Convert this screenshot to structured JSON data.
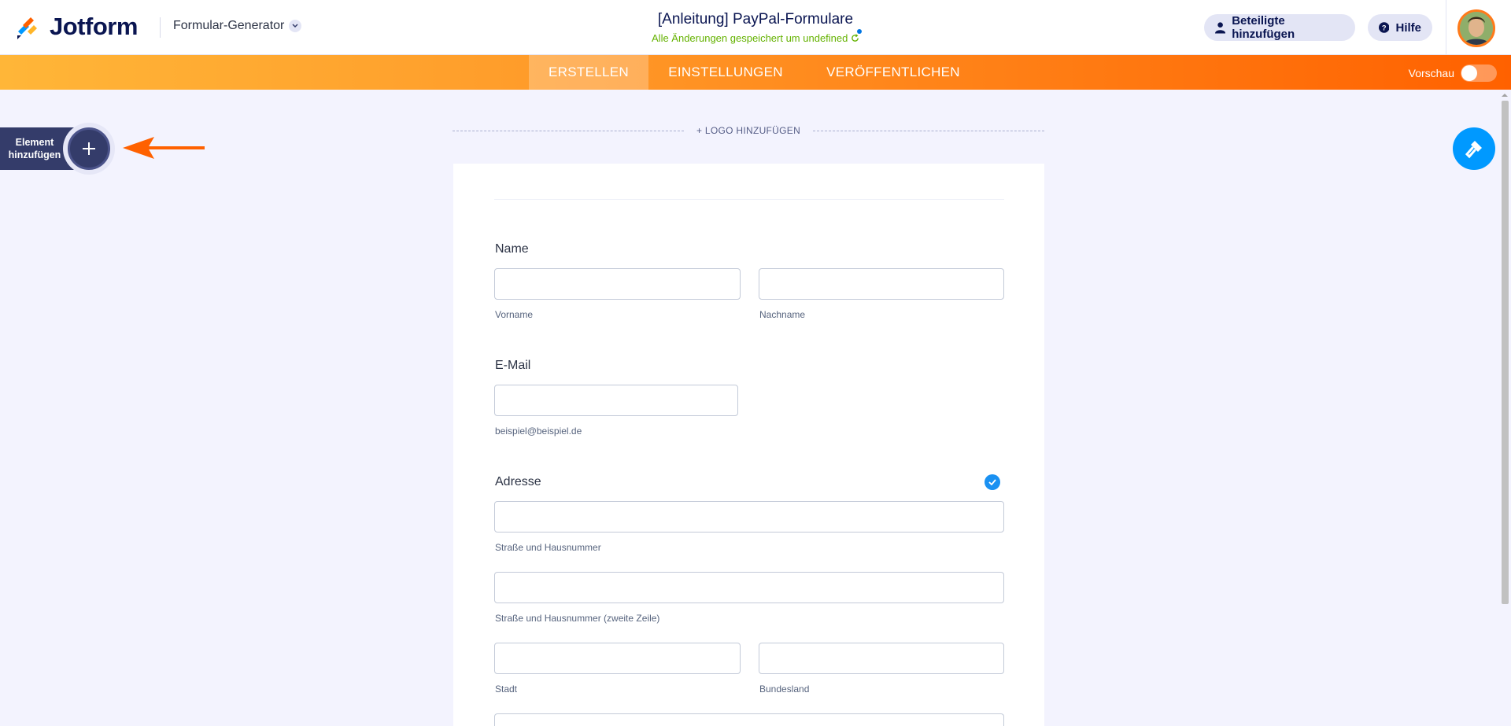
{
  "header": {
    "brand": "Jotform",
    "generator_label": "Formular-Generator",
    "form_title": "[Anleitung] PayPal-Formulare",
    "save_status": "Alle Änderungen gespeichert um undefined",
    "invite_label": "Beteiligte hinzufügen",
    "help_label": "Hilfe"
  },
  "nav": {
    "tabs": [
      {
        "label": "ERSTELLEN",
        "active": true
      },
      {
        "label": "EINSTELLUNGEN",
        "active": false
      },
      {
        "label": "VERÖFFENTLICHEN",
        "active": false
      }
    ],
    "preview_label": "Vorschau"
  },
  "sidebar": {
    "add_element_line1": "Element",
    "add_element_line2": "hinzufügen"
  },
  "form": {
    "logo_add": "+ LOGO HINZUFÜGEN",
    "name": {
      "label": "Name",
      "first": "Vorname",
      "last": "Nachname"
    },
    "email": {
      "label": "E-Mail",
      "hint": "beispiel@beispiel.de"
    },
    "address": {
      "label": "Adresse",
      "street": "Straße und Hausnummer",
      "street2": "Straße und Hausnummer (zweite Zeile)",
      "city": "Stadt",
      "state": "Bundesland"
    }
  },
  "colors": {
    "accent_orange": "#ff6100",
    "brand_navy": "#0a1551",
    "save_green": "#64b200",
    "design_blue": "#0099ff"
  }
}
